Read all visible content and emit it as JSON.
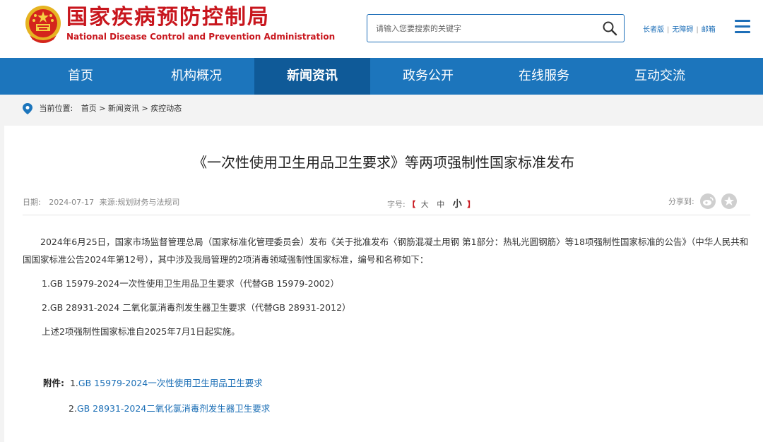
{
  "header": {
    "site_name_cn": "国家疾病预防控制局",
    "site_name_en": "National Disease Control and Prevention Administration",
    "search_placeholder": "请输入您要搜索的关键字",
    "links": [
      "长者版",
      "无障碍",
      "邮箱"
    ]
  },
  "nav": {
    "items": [
      "首页",
      "机构概况",
      "新闻资讯",
      "政务公开",
      "在线服务",
      "互动交流"
    ],
    "active_index": 2
  },
  "breadcrumb": {
    "label": "当前位置:",
    "items": [
      "首页",
      "新闻资讯",
      "疾控动态"
    ],
    "separator": ">"
  },
  "article": {
    "title": "《一次性使用卫生用品卫生要求》等两项强制性国家标准发布",
    "date_label": "日期:",
    "date": "2024-07-17",
    "source_label": "来源:",
    "source": "规划财务与法规司",
    "fontsize_label": "字号:",
    "fontsize_open": "【",
    "fontsize_close": "】",
    "fontsize_options": [
      "大",
      "中",
      "小"
    ],
    "share_label": "分享到:",
    "paragraphs": [
      "2024年6月25日，国家市场监督管理总局（国家标准化管理委员会）发布《关于批准发布〈钢筋混凝土用钢 第1部分：热轧光圆钢筋〉等18项强制性国家标准的公告》（中华人民共和国国家标准公告2024年第12号），其中涉及我局管理的2项消毒领域强制性国家标准，编号和名称如下：",
      "1.GB 15979-2024一次性使用卫生用品卫生要求（代替GB 15979-2002）",
      "2.GB 28931-2024 二氧化氯消毒剂发生器卫生要求（代替GB 28931-2012）",
      "上述2项强制性国家标准自2025年7月1日起实施。"
    ],
    "attachments_label": "附件:",
    "attachments": [
      {
        "num": "1.",
        "text": "GB 15979-2024一次性使用卫生用品卫生要求"
      },
      {
        "num": "2.",
        "text": "GB 28931-2024二氧化氯消毒剂发生器卫生要求"
      }
    ]
  },
  "colors": {
    "brand_red": "#c8161d",
    "nav_blue": "#1c75bc",
    "nav_active": "#0f5a98",
    "link_blue": "#1c6fb6"
  }
}
